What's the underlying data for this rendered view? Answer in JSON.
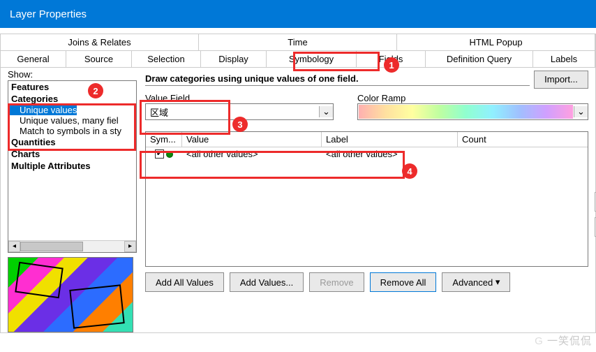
{
  "window": {
    "title": "Layer Properties"
  },
  "tabs": {
    "top": [
      "Joins & Relates",
      "Time",
      "HTML Popup"
    ],
    "bottom": [
      "General",
      "Source",
      "Selection",
      "Display",
      "Symbology",
      "Fields",
      "Definition Query",
      "Labels"
    ]
  },
  "left": {
    "show_label": "Show:",
    "tree": {
      "features": "Features",
      "categories": "Categories",
      "cat_items": [
        "Unique values",
        "Unique values, many fiel",
        "Match to symbols in a sty"
      ],
      "quantities": "Quantities",
      "charts": "Charts",
      "multi": "Multiple Attributes"
    }
  },
  "right": {
    "desc": "Draw categories using unique values of one field.",
    "import": "Import...",
    "value_field_label": "Value Field",
    "value_field_value": "区域",
    "color_ramp_label": "Color Ramp",
    "headers": {
      "sym": "Sym...",
      "value": "Value",
      "label": "Label",
      "count": "Count"
    },
    "row1": {
      "value": "<all other values>",
      "label": "<all other values>"
    },
    "buttons": {
      "add_all": "Add All Values",
      "add": "Add Values...",
      "remove": "Remove",
      "remove_all": "Remove All",
      "advanced": "Advanced"
    }
  },
  "watermark": "一笑侃侃"
}
